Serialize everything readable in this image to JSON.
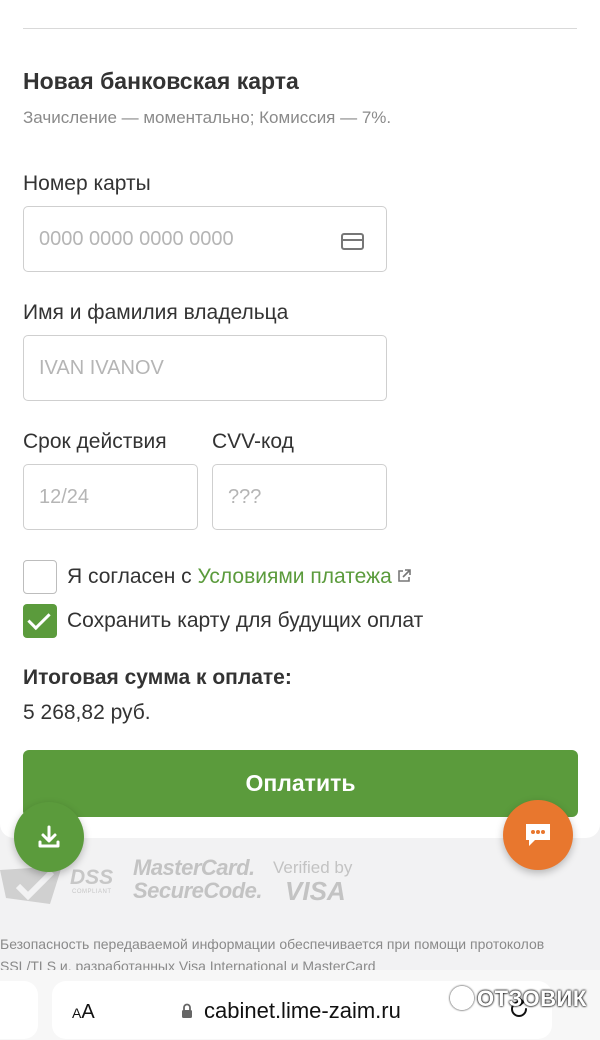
{
  "section": {
    "title": "Новая банковская карта",
    "subtitle": "Зачисление — моментально; Комиссия — 7%."
  },
  "card_number": {
    "label": "Номер карты",
    "placeholder": "0000 0000 0000 0000",
    "icon": "credit-card-icon"
  },
  "holder_name": {
    "label": "Имя и фамилия владельца",
    "placeholder": "IVAN IVANOV"
  },
  "expiry": {
    "label": "Срок действия",
    "placeholder": "12/24"
  },
  "cvv": {
    "label": "CVV-код",
    "placeholder": "???"
  },
  "agree": {
    "checked": false,
    "text": "Я согласен с ",
    "link_text": "Условиями платежа"
  },
  "save_card": {
    "checked": true,
    "text": "Сохранить карту для будущих оплат"
  },
  "total": {
    "label": "Итоговая сумма к оплате:",
    "value": "5 268,82 руб."
  },
  "pay_button": {
    "label": "Оплатить"
  },
  "logos": {
    "pci": "DSS",
    "pci_small": "COMPLIANT",
    "mastercard_line1": "MasterCard.",
    "mastercard_line2": "SecureCode.",
    "visa_line1": "Verified by",
    "visa_line2": "VISA"
  },
  "security_text": "Безопасность передаваемой информации обеспечивается при помощи протоколов SSL/TLS и, разработанных Visa International и MasterCard",
  "browser": {
    "text_size_label_small": "A",
    "text_size_label": "A",
    "url": "cabinet.lime-zaim.ru"
  },
  "watermark": "ОТЗОВИК",
  "colors": {
    "accent_green": "#5b9b3c",
    "chat_orange": "#e8772e",
    "link_green": "#5b9b3c"
  }
}
